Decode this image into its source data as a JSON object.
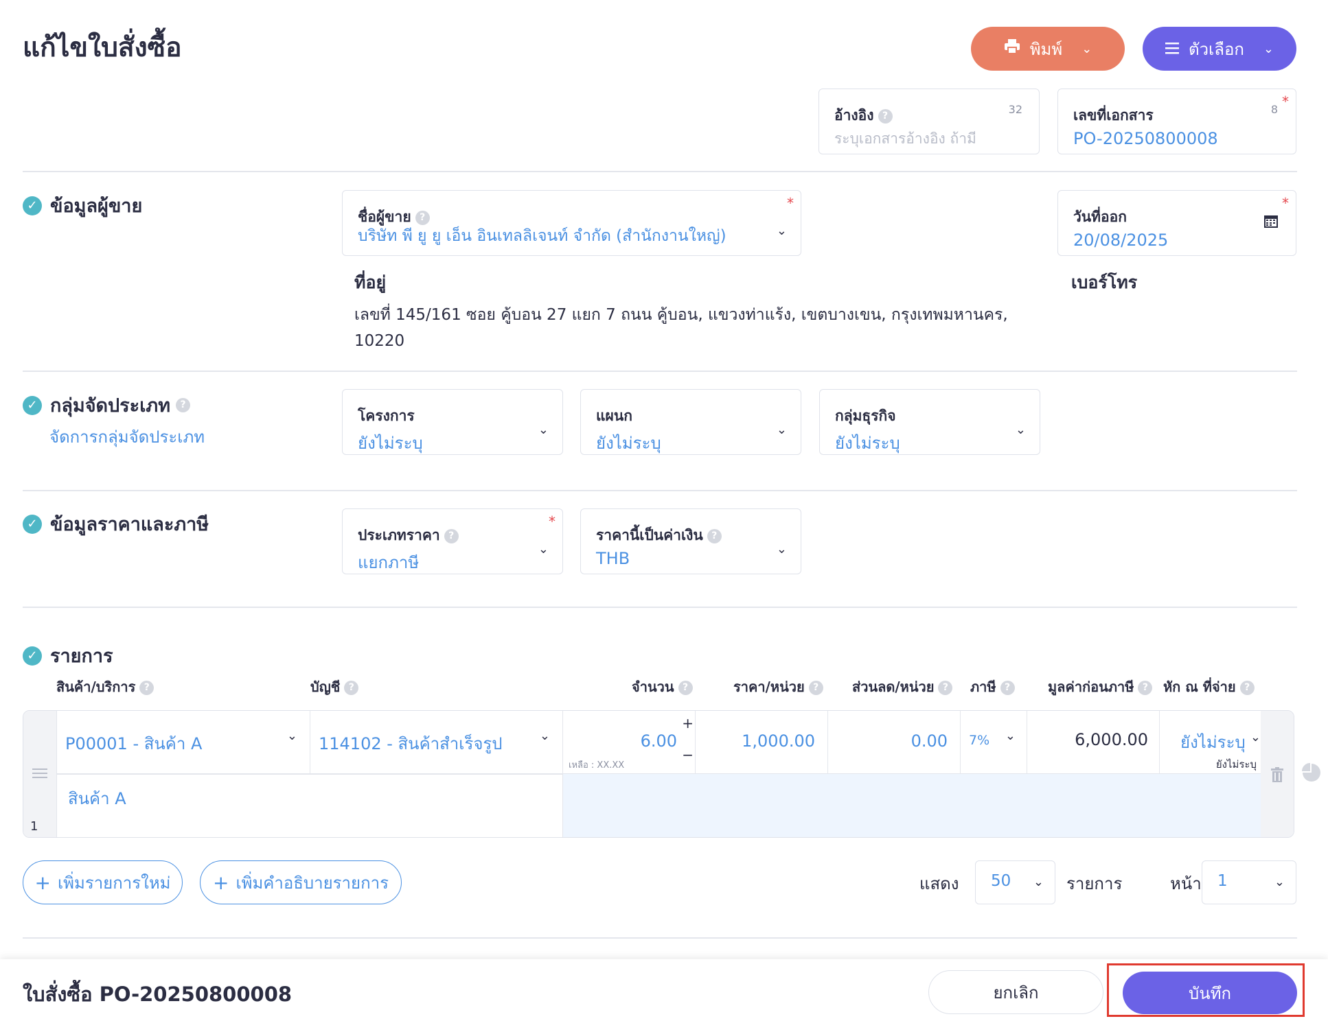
{
  "header": {
    "title": "แก้ไขใบสั่งซื้อ",
    "print_label": "พิมพ์",
    "options_label": "ตัวเลือก"
  },
  "reference": {
    "label": "อ้างอิง",
    "placeholder": "ระบุเอกสารอ้างอิง ถ้ามี",
    "count": "32"
  },
  "doc_no": {
    "label": "เลขที่เอกสาร",
    "value": "PO-20250800008",
    "count": "8"
  },
  "required_mark": "*",
  "seller": {
    "section_title": "ข้อมูลผู้ขาย",
    "name_label": "ชื่อผู้ขาย",
    "name_value": "บริษัท พี ยู ยู เอ็น อินเทลลิเจนท์ จำกัด (สำนักงานใหญ่)",
    "address_label": "ที่อยู่",
    "address_value": "เลขที่ 145/161 ซอย คู้บอน 27 แยก 7 ถนน คู้บอน, แขวงท่าแร้ง, เขตบางเขน, กรุงเทพมหานคร, 10220",
    "phone_label": "เบอร์โทร"
  },
  "issue_date": {
    "label": "วันที่ออก",
    "value": "20/08/2025"
  },
  "classification": {
    "section_title": "กลุ่มจัดประเภท",
    "manage_link": "จัดการกลุ่มจัดประเภท",
    "project": {
      "label": "โครงการ",
      "value": "ยังไม่ระบุ"
    },
    "department": {
      "label": "แผนก",
      "value": "ยังไม่ระบุ"
    },
    "business_group": {
      "label": "กลุ่มธุรกิจ",
      "value": "ยังไม่ระบุ"
    }
  },
  "pricing": {
    "section_title": "ข้อมูลราคาและภาษี",
    "price_type": {
      "label": "ประเภทราคา",
      "value": "แยกภาษี"
    },
    "currency": {
      "label": "ราคานี้เป็นค่าเงิน",
      "value": "THB"
    }
  },
  "items": {
    "section_title": "รายการ",
    "columns": {
      "product": "สินค้า/บริการ",
      "account": "บัญชี",
      "qty": "จำนวน",
      "unit_price": "ราคา/หน่วย",
      "discount": "ส่วนลด/หน่วย",
      "tax": "ภาษี",
      "pre_tax": "มูลค่าก่อนภาษี",
      "withholding": "หัก ณ ที่จ่าย"
    },
    "rows": [
      {
        "index": "1",
        "product": "P00001 - สินค้า A",
        "account": "114102 - สินค้าสำเร็จรูป",
        "qty": "6.00",
        "remaining": "เหลือ : XX.XX",
        "unit_price": "1,000.00",
        "discount": "0.00",
        "tax": "7%",
        "pre_tax": "6,000.00",
        "withholding": "ยังไม่ระบุ",
        "withholding_sub": "ยังไม่ระบุ",
        "description": "สินค้า A"
      }
    ],
    "add_item_label": "เพิ่มรายการใหม่",
    "add_desc_label": "เพิ่มคำอธิบายรายการ"
  },
  "pagination": {
    "show_label": "แสดง",
    "per_page": "50",
    "items_label": "รายการ",
    "page_label": "หน้า",
    "page": "1"
  },
  "footer": {
    "title": "ใบสั่งซื้อ PO-20250800008",
    "cancel_label": "ยกเลิก",
    "save_label": "บันทึก"
  },
  "colors": {
    "print": "#e97f64",
    "primary": "#6b62e6",
    "link": "#4a90e2",
    "check": "#4fb7c6",
    "highlight": "#e03a2f"
  }
}
